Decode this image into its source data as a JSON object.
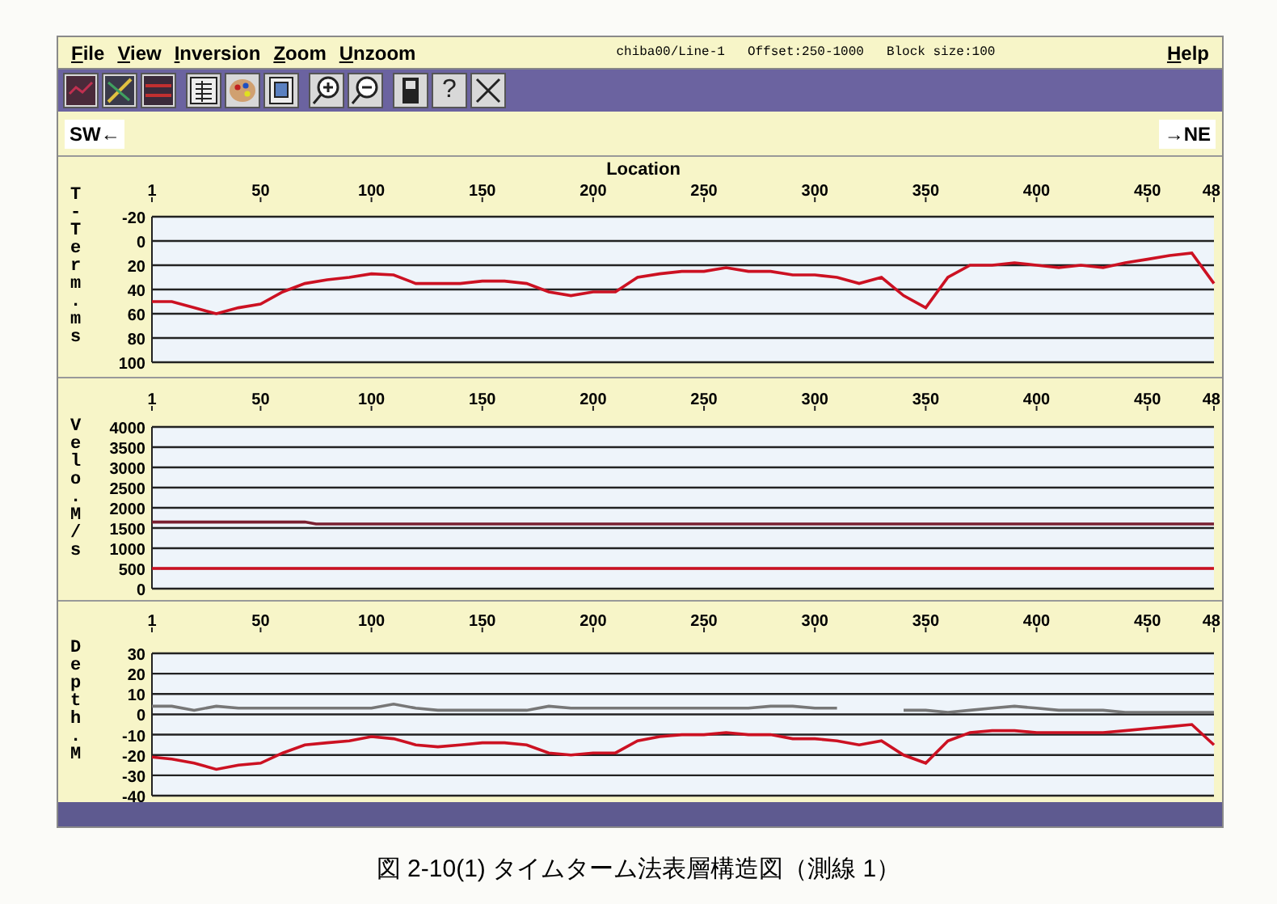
{
  "menu": [
    {
      "label": "File"
    },
    {
      "label": "View"
    },
    {
      "label": "Inversion"
    },
    {
      "label": "Zoom"
    },
    {
      "label": "Unzoom"
    }
  ],
  "info": [
    "chiba00/Line-1",
    "Offset:250-1000",
    "Block size:100"
  ],
  "help_menu": {
    "label": "Help"
  },
  "toolbar": [
    {
      "kind": "plot"
    },
    {
      "kind": "pick"
    },
    {
      "kind": "layers"
    },
    {
      "kind": "table"
    },
    {
      "kind": "palette"
    },
    {
      "kind": "document"
    },
    {
      "kind": "zoom-in"
    },
    {
      "kind": "zoom-out"
    },
    {
      "kind": "device"
    },
    {
      "kind": "help",
      "label": "?"
    },
    {
      "kind": "close"
    }
  ],
  "direction_left": "SW←",
  "direction_right": "→NE",
  "panels": [
    {
      "edge_tick_label": "48",
      "chart_data": {
        "type": "line",
        "grid": true,
        "xlabel": "Location",
        "ylabel": "T-Term. ms",
        "xlim": [
          1,
          480
        ],
        "ylim": [
          100,
          -20
        ],
        "xticks": [
          1,
          50,
          100,
          150,
          200,
          250,
          300,
          350,
          400,
          450
        ],
        "yticks": [
          -20,
          0,
          20,
          40,
          60,
          80,
          100
        ],
        "x": [
          1,
          10,
          20,
          30,
          40,
          50,
          60,
          70,
          80,
          90,
          100,
          110,
          120,
          130,
          140,
          150,
          160,
          170,
          180,
          190,
          200,
          210,
          220,
          230,
          240,
          250,
          260,
          270,
          280,
          290,
          300,
          310,
          320,
          330,
          340,
          350,
          360,
          370,
          380,
          390,
          400,
          410,
          420,
          430,
          440,
          450,
          460,
          470,
          480
        ],
        "series": [
          {
            "color": "#cc1122",
            "values": [
              50,
              50,
              55,
              60,
              55,
              52,
              42,
              35,
              32,
              30,
              27,
              28,
              35,
              35,
              35,
              33,
              33,
              35,
              42,
              45,
              42,
              42,
              30,
              27,
              25,
              25,
              22,
              25,
              25,
              28,
              28,
              30,
              35,
              30,
              45,
              55,
              30,
              20,
              20,
              18,
              20,
              22,
              20,
              22,
              18,
              15,
              12,
              10,
              35
            ]
          }
        ]
      }
    },
    {
      "edge_tick_label": "48",
      "chart_data": {
        "type": "line",
        "grid": true,
        "ylabel": "Velo. M/s",
        "xlim": [
          1,
          480
        ],
        "ylim": [
          0,
          4000
        ],
        "xticks": [
          1,
          50,
          100,
          150,
          200,
          250,
          300,
          350,
          400,
          450
        ],
        "yticks": [
          0,
          500,
          1000,
          1500,
          2000,
          2500,
          3000,
          3500,
          4000
        ],
        "x": [
          1,
          70,
          75,
          480
        ],
        "series": [
          {
            "color": "#7a2030",
            "values": [
              1650,
              1650,
              1600,
              1600
            ]
          },
          {
            "color": "#cc1122",
            "values": [
              500,
              500,
              500,
              500
            ]
          }
        ]
      }
    },
    {
      "edge_tick_label": "48",
      "chart_data": {
        "type": "line",
        "grid": true,
        "ylabel": "Depth. M",
        "xlim": [
          1,
          480
        ],
        "ylim": [
          -40,
          30
        ],
        "xticks": [
          1,
          50,
          100,
          150,
          200,
          250,
          300,
          350,
          400,
          450
        ],
        "yticks": [
          -40,
          -30,
          -20,
          -10,
          0,
          10,
          20,
          30
        ],
        "x": [
          1,
          10,
          20,
          30,
          40,
          50,
          60,
          70,
          80,
          90,
          100,
          110,
          120,
          130,
          140,
          150,
          160,
          170,
          180,
          190,
          200,
          210,
          220,
          230,
          240,
          250,
          260,
          270,
          280,
          290,
          300,
          310,
          320,
          330,
          340,
          350,
          360,
          370,
          380,
          390,
          400,
          410,
          420,
          430,
          440,
          450,
          460,
          470,
          480
        ],
        "series": [
          {
            "color": "#777777",
            "values": [
              4,
              4,
              2,
              4,
              3,
              3,
              3,
              3,
              3,
              3,
              3,
              5,
              3,
              2,
              2,
              2,
              2,
              2,
              4,
              3,
              3,
              3,
              3,
              3,
              3,
              3,
              3,
              3,
              4,
              4,
              3,
              3,
              null,
              null,
              2,
              2,
              1,
              2,
              3,
              4,
              3,
              2,
              2,
              2,
              1,
              1,
              1,
              1,
              1
            ]
          },
          {
            "color": "#cc1122",
            "values": [
              -21,
              -22,
              -24,
              -27,
              -25,
              -24,
              -19,
              -15,
              -14,
              -13,
              -11,
              -12,
              -15,
              -16,
              -15,
              -14,
              -14,
              -15,
              -19,
              -20,
              -19,
              -19,
              -13,
              -11,
              -10,
              -10,
              -9,
              -10,
              -10,
              -12,
              -12,
              -13,
              -15,
              -13,
              -20,
              -24,
              -13,
              -9,
              -8,
              -8,
              -9,
              -9,
              -9,
              -9,
              -8,
              -7,
              -6,
              -5,
              -15
            ]
          }
        ]
      }
    }
  ],
  "caption": "図 2-10(1) タイムターム法表層構造図（測線 1）"
}
